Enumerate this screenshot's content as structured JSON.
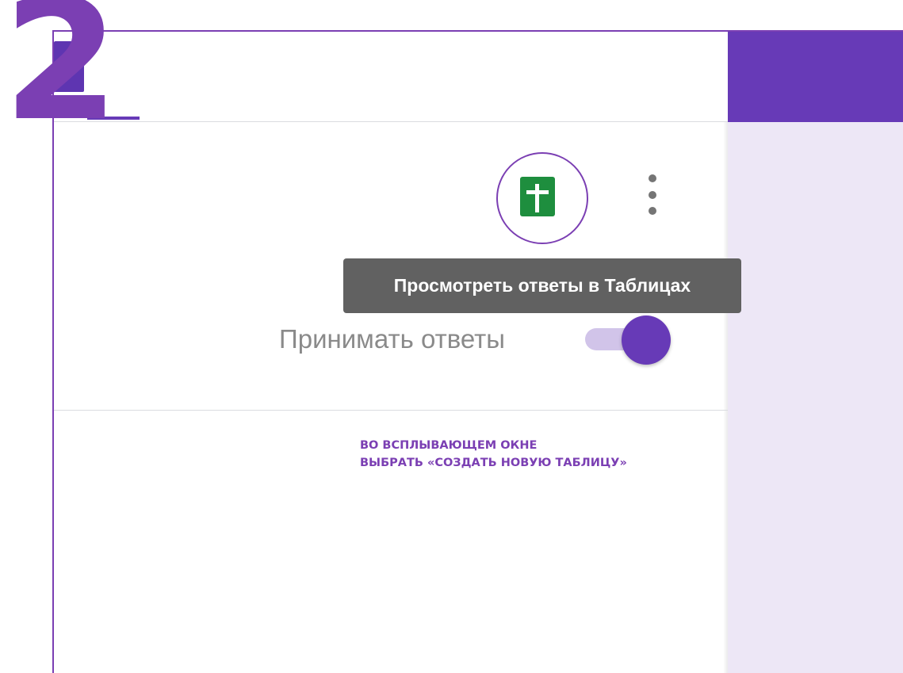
{
  "step": {
    "number": "2"
  },
  "toolbar": {
    "sheets_button_icon": "google-sheets-icon",
    "more_button_icon": "more-vert-icon"
  },
  "tooltip": {
    "text": "Просмотреть ответы в Таблицах"
  },
  "responses": {
    "accept_label": "Принимать ответы",
    "accept_toggle_on": true
  },
  "instruction": {
    "line1": "ВО ВСПЛЫВАЮЩЕМ ОКНЕ",
    "line2": "ВЫБРАТЬ «СОЗДАТЬ НОВУЮ ТАБЛИЦУ»"
  },
  "colors": {
    "accent": "#673ab7",
    "annotation": "#7b3fb3",
    "sheets_green": "#1e8e3e",
    "tooltip_bg": "#616161",
    "side_panel": "#ede7f6"
  }
}
